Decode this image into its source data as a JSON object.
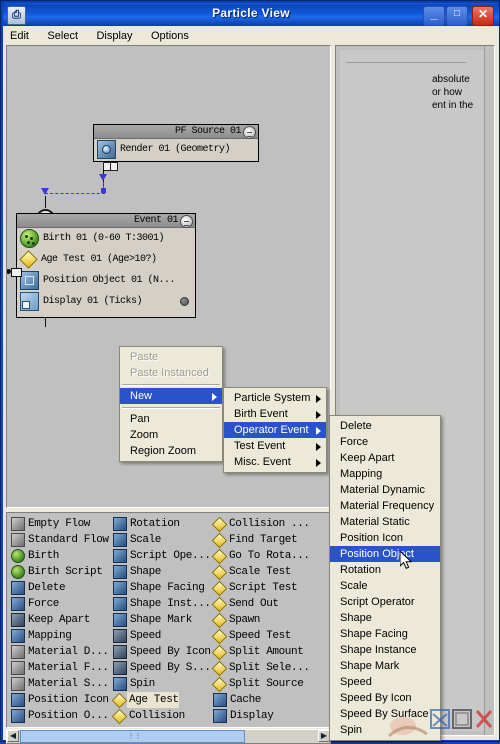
{
  "window": {
    "title": "Particle View",
    "app_icon": "particle-view-icon",
    "minimize_label": "_",
    "maximize_label": "□",
    "close_label": "✕",
    "titlebar_color": "#0f56d8",
    "accent_color": "#2a53c9"
  },
  "menubar": {
    "items": [
      {
        "label": "Edit"
      },
      {
        "label": "Select"
      },
      {
        "label": "Display"
      },
      {
        "label": "Options"
      }
    ]
  },
  "graph": {
    "pf_source": {
      "header": "PF Source 01",
      "rows": [
        {
          "label": "Render 01  (Geometry)",
          "icon": "render-icon"
        }
      ]
    },
    "event": {
      "header": "Event 01",
      "rows": [
        {
          "label": "Birth 01  (0-60 T:3001)",
          "icon": "birth-icon"
        },
        {
          "label": "Age Test 01  (Age>10?)",
          "icon": "test-diamond-icon"
        },
        {
          "label": "Position Object 01  (N...",
          "icon": "position-object-icon"
        },
        {
          "label": "Display 01  (Ticks)",
          "icon": "display-icon"
        }
      ]
    }
  },
  "param_panel": {
    "lines": [
      "absolute",
      "or how",
      "ent in the"
    ]
  },
  "depot": {
    "columns": [
      {
        "items": [
          {
            "label": "Empty Flow",
            "icon": "empty-flow-icon",
            "kind": "gray"
          },
          {
            "label": "Standard Flow",
            "icon": "standard-flow-icon",
            "kind": "gray"
          },
          {
            "label": "Birth",
            "icon": "birth-icon",
            "kind": "green"
          },
          {
            "label": "Birth Script",
            "icon": "birth-script-icon",
            "kind": "green"
          },
          {
            "label": "Delete",
            "icon": "delete-icon",
            "kind": "blue"
          },
          {
            "label": "Force",
            "icon": "force-icon",
            "kind": "blue"
          },
          {
            "label": "Keep Apart",
            "icon": "keep-apart-icon",
            "kind": "dark"
          },
          {
            "label": "Mapping",
            "icon": "mapping-icon",
            "kind": "blue"
          },
          {
            "label": "Material D...",
            "icon": "material-dynamic-icon",
            "kind": "gray"
          },
          {
            "label": "Material F...",
            "icon": "material-frequency-icon",
            "kind": "gray"
          },
          {
            "label": "Material S...",
            "icon": "material-static-icon",
            "kind": "gray"
          },
          {
            "label": "Position Icon",
            "icon": "position-icon-icon",
            "kind": "blue"
          },
          {
            "label": "Position O...",
            "icon": "position-object-icon",
            "kind": "blue"
          }
        ]
      },
      {
        "items": [
          {
            "label": "Rotation",
            "icon": "rotation-icon",
            "kind": "blue"
          },
          {
            "label": "Scale",
            "icon": "scale-icon",
            "kind": "blue"
          },
          {
            "label": "Script Ope...",
            "icon": "script-operator-icon",
            "kind": "blue"
          },
          {
            "label": "Shape",
            "icon": "shape-icon",
            "kind": "blue"
          },
          {
            "label": "Shape Facing",
            "icon": "shape-facing-icon",
            "kind": "blue"
          },
          {
            "label": "Shape Inst...",
            "icon": "shape-instance-icon",
            "kind": "blue"
          },
          {
            "label": "Shape Mark",
            "icon": "shape-mark-icon",
            "kind": "blue"
          },
          {
            "label": "Speed",
            "icon": "speed-icon",
            "kind": "dark"
          },
          {
            "label": "Speed By Icon",
            "icon": "speed-by-icon-icon",
            "kind": "dark"
          },
          {
            "label": "Speed By S...",
            "icon": "speed-by-surface-icon",
            "kind": "dark"
          },
          {
            "label": "Spin",
            "icon": "spin-icon",
            "kind": "blue"
          },
          {
            "label": "Age Test",
            "icon": "age-test-icon",
            "kind": "yellow",
            "selected": true
          },
          {
            "label": "Collision",
            "icon": "collision-icon",
            "kind": "yellow"
          }
        ]
      },
      {
        "items": [
          {
            "label": "Collision ...",
            "icon": "collision-spawn-icon",
            "kind": "yellow"
          },
          {
            "label": "Find Target",
            "icon": "find-target-icon",
            "kind": "yellow"
          },
          {
            "label": "Go To Rota...",
            "icon": "go-to-rotation-icon",
            "kind": "yellow"
          },
          {
            "label": "Scale Test",
            "icon": "scale-test-icon",
            "kind": "yellow"
          },
          {
            "label": "Script Test",
            "icon": "script-test-icon",
            "kind": "yellow"
          },
          {
            "label": "Send Out",
            "icon": "send-out-icon",
            "kind": "yellow"
          },
          {
            "label": "Spawn",
            "icon": "spawn-icon",
            "kind": "yellow"
          },
          {
            "label": "Speed Test",
            "icon": "speed-test-icon",
            "kind": "yellow"
          },
          {
            "label": "Split Amount",
            "icon": "split-amount-icon",
            "kind": "yellow"
          },
          {
            "label": "Split Sele...",
            "icon": "split-selected-icon",
            "kind": "yellow"
          },
          {
            "label": "Split Source",
            "icon": "split-source-icon",
            "kind": "yellow"
          },
          {
            "label": "Cache",
            "icon": "cache-icon",
            "kind": "blue"
          },
          {
            "label": "Display",
            "icon": "display-icon",
            "kind": "blue"
          }
        ]
      }
    ]
  },
  "context_menu": {
    "items": [
      {
        "label": "Paste",
        "state": "disabled"
      },
      {
        "label": "Paste Instanced",
        "state": "disabled"
      },
      {
        "label": "",
        "state": "separator"
      },
      {
        "label": "New",
        "state": "highlighted",
        "submenu": true
      },
      {
        "label": "",
        "state": "separator"
      },
      {
        "label": "Pan",
        "state": "normal"
      },
      {
        "label": "Zoom",
        "state": "normal"
      },
      {
        "label": "Region Zoom",
        "state": "normal"
      }
    ]
  },
  "new_submenu": {
    "items": [
      {
        "label": "Particle System",
        "state": "normal",
        "submenu": true
      },
      {
        "label": "Birth Event",
        "state": "normal",
        "submenu": true
      },
      {
        "label": "Operator Event",
        "state": "highlighted",
        "submenu": true
      },
      {
        "label": "Test Event",
        "state": "normal",
        "submenu": true
      },
      {
        "label": "Misc. Event",
        "state": "normal",
        "submenu": true
      }
    ]
  },
  "operator_submenu": {
    "items": [
      {
        "label": "Delete",
        "state": "normal"
      },
      {
        "label": "Force",
        "state": "normal"
      },
      {
        "label": "Keep Apart",
        "state": "normal"
      },
      {
        "label": "Mapping",
        "state": "normal"
      },
      {
        "label": "Material Dynamic",
        "state": "normal"
      },
      {
        "label": "Material Frequency",
        "state": "normal"
      },
      {
        "label": "Material Static",
        "state": "normal"
      },
      {
        "label": "Position Icon",
        "state": "normal"
      },
      {
        "label": "Position Object",
        "state": "highlighted"
      },
      {
        "label": "Rotation",
        "state": "normal"
      },
      {
        "label": "Scale",
        "state": "normal"
      },
      {
        "label": "Script Operator",
        "state": "normal"
      },
      {
        "label": "Shape",
        "state": "normal"
      },
      {
        "label": "Shape Facing",
        "state": "normal"
      },
      {
        "label": "Shape Instance",
        "state": "normal"
      },
      {
        "label": "Shape Mark",
        "state": "normal"
      },
      {
        "label": "Speed",
        "state": "normal"
      },
      {
        "label": "Speed By Icon",
        "state": "normal"
      },
      {
        "label": "Speed By Surface",
        "state": "normal"
      },
      {
        "label": "Spin",
        "state": "normal"
      }
    ]
  }
}
